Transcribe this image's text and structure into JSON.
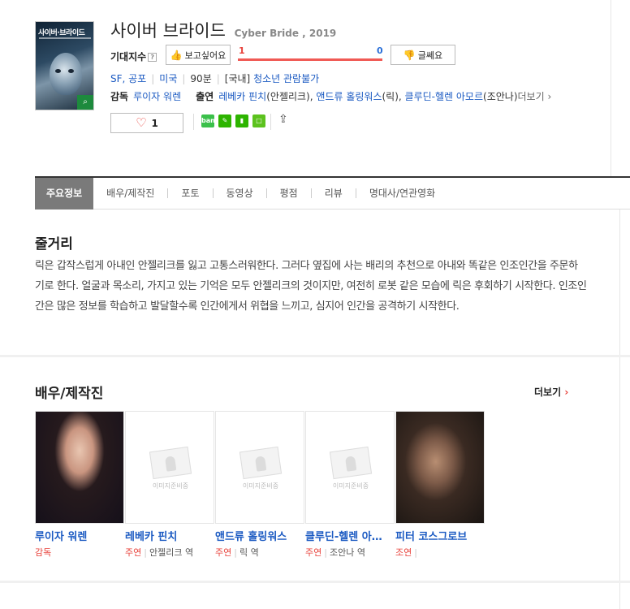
{
  "movie": {
    "title": "사이버 브라이드",
    "subtitle": "Cyber Bride , 2019",
    "poster_title": "사이버·브라이드"
  },
  "rating": {
    "label": "기대지수",
    "help_icon": "?",
    "want_label": "보고싶어요",
    "nope_label": "글쎄요",
    "want_count": "1",
    "nope_count": "0",
    "want_fraction": 1.0
  },
  "meta": {
    "genre": "SF, 공포",
    "country": "미국",
    "runtime": "90분",
    "rating_prefix": "[국내]",
    "rating": "청소년 관람불가"
  },
  "crew": {
    "director_label": "감독",
    "director": "루이자 워렌",
    "cast_label": "출연",
    "cast_1": "레베카 핀치",
    "cast_1_role": "(안젤리크),",
    "cast_2": "앤드류 홀링워스",
    "cast_2_role": "(릭),",
    "cast_3": "클루딘-헬렌 아모르",
    "cast_3_role": "(조안나)",
    "more": "더보기"
  },
  "like": {
    "count": "1"
  },
  "share_icons": [
    {
      "name": "band-icon",
      "label": "band",
      "color": "#3ac04a"
    },
    {
      "name": "kakaostory-icon",
      "label": "",
      "color": "#2db400"
    },
    {
      "name": "bookmark-icon",
      "label": "",
      "color": "#2db400"
    },
    {
      "name": "memo-icon",
      "label": "",
      "color": "#5cc21e"
    }
  ],
  "tabs": [
    "주요정보",
    "배우/제작진",
    "포토",
    "동영상",
    "평점",
    "리뷰",
    "명대사/연관영화"
  ],
  "synopsis": {
    "heading": "줄거리",
    "text": "릭은 갑작스럽게 아내인 안젤리크를 잃고 고통스러워한다. 그러다 옆집에 사는 배리의 추천으로 아내와 똑같은 인조인간을 주문하기로 한다. 얼굴과 목소리, 가지고 있는 기억은 모두 안젤리크의 것이지만, 여전히 로봇 같은 모습에 릭은 후회하기 시작한다. 인조인간은 많은 정보를 학습하고 발달할수록 인간에게서 위협을 느끼고, 심지어 인간을 공격하기 시작한다."
  },
  "cast_section": {
    "heading": "배우/제작진",
    "more": "더보기",
    "placeholder_text": "이미지준비중",
    "people": [
      {
        "name": "루이자 워렌",
        "role": "감독",
        "character": ""
      },
      {
        "name": "레베카 핀치",
        "role": "주연",
        "character": "안젤리크 역"
      },
      {
        "name": "앤드류 홀링워스",
        "role": "주연",
        "character": "릭 역"
      },
      {
        "name": "클루딘-헬렌 아모르",
        "role": "주연",
        "character": "조안나 역"
      },
      {
        "name": "피터 코스그로브",
        "role": "조연",
        "character": ""
      }
    ]
  }
}
